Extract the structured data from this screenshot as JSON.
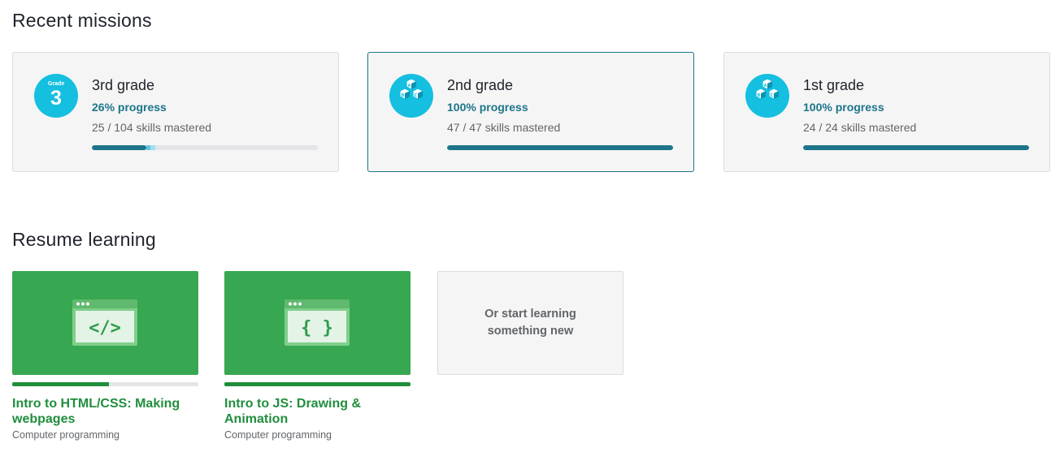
{
  "missions_section": {
    "title": "Recent missions",
    "cards": [
      {
        "badge_type": "grade-3-badge-icon",
        "badge_label": "Grade",
        "badge_number": "3",
        "title": "3rd grade",
        "progress": "26% progress",
        "skills": "25 / 104 skills mastered",
        "mastered_fraction": 0.24,
        "practiced_fraction": 0.02,
        "familiar_fraction": 0.02,
        "selected": false
      },
      {
        "badge_type": "blocks-icon",
        "title": "2nd grade",
        "progress": "100% progress",
        "skills": "47 / 47 skills mastered",
        "mastered_fraction": 1.0,
        "selected": true
      },
      {
        "badge_type": "blocks-icon",
        "title": "1st grade",
        "progress": "100% progress",
        "skills": "24 / 24 skills mastered",
        "mastered_fraction": 1.0,
        "selected": false
      }
    ]
  },
  "resume_section": {
    "title": "Resume learning",
    "courses": [
      {
        "icon": "html-code-window-icon",
        "icon_glyph": "</>",
        "title": "Intro to HTML/CSS: Making webpages",
        "subject": "Computer programming",
        "progress_fraction": 0.52
      },
      {
        "icon": "js-code-window-icon",
        "icon_glyph": "{ }",
        "title": "Intro to JS: Drawing & Animation",
        "subject": "Computer programming",
        "progress_fraction": 1.0
      }
    ],
    "start_new_label": "Or start learning something new"
  },
  "colors": {
    "badge_blue": "#14bfe0",
    "progress_teal": "#1c758a",
    "course_green": "#37a752",
    "course_text_green": "#208e3d"
  }
}
